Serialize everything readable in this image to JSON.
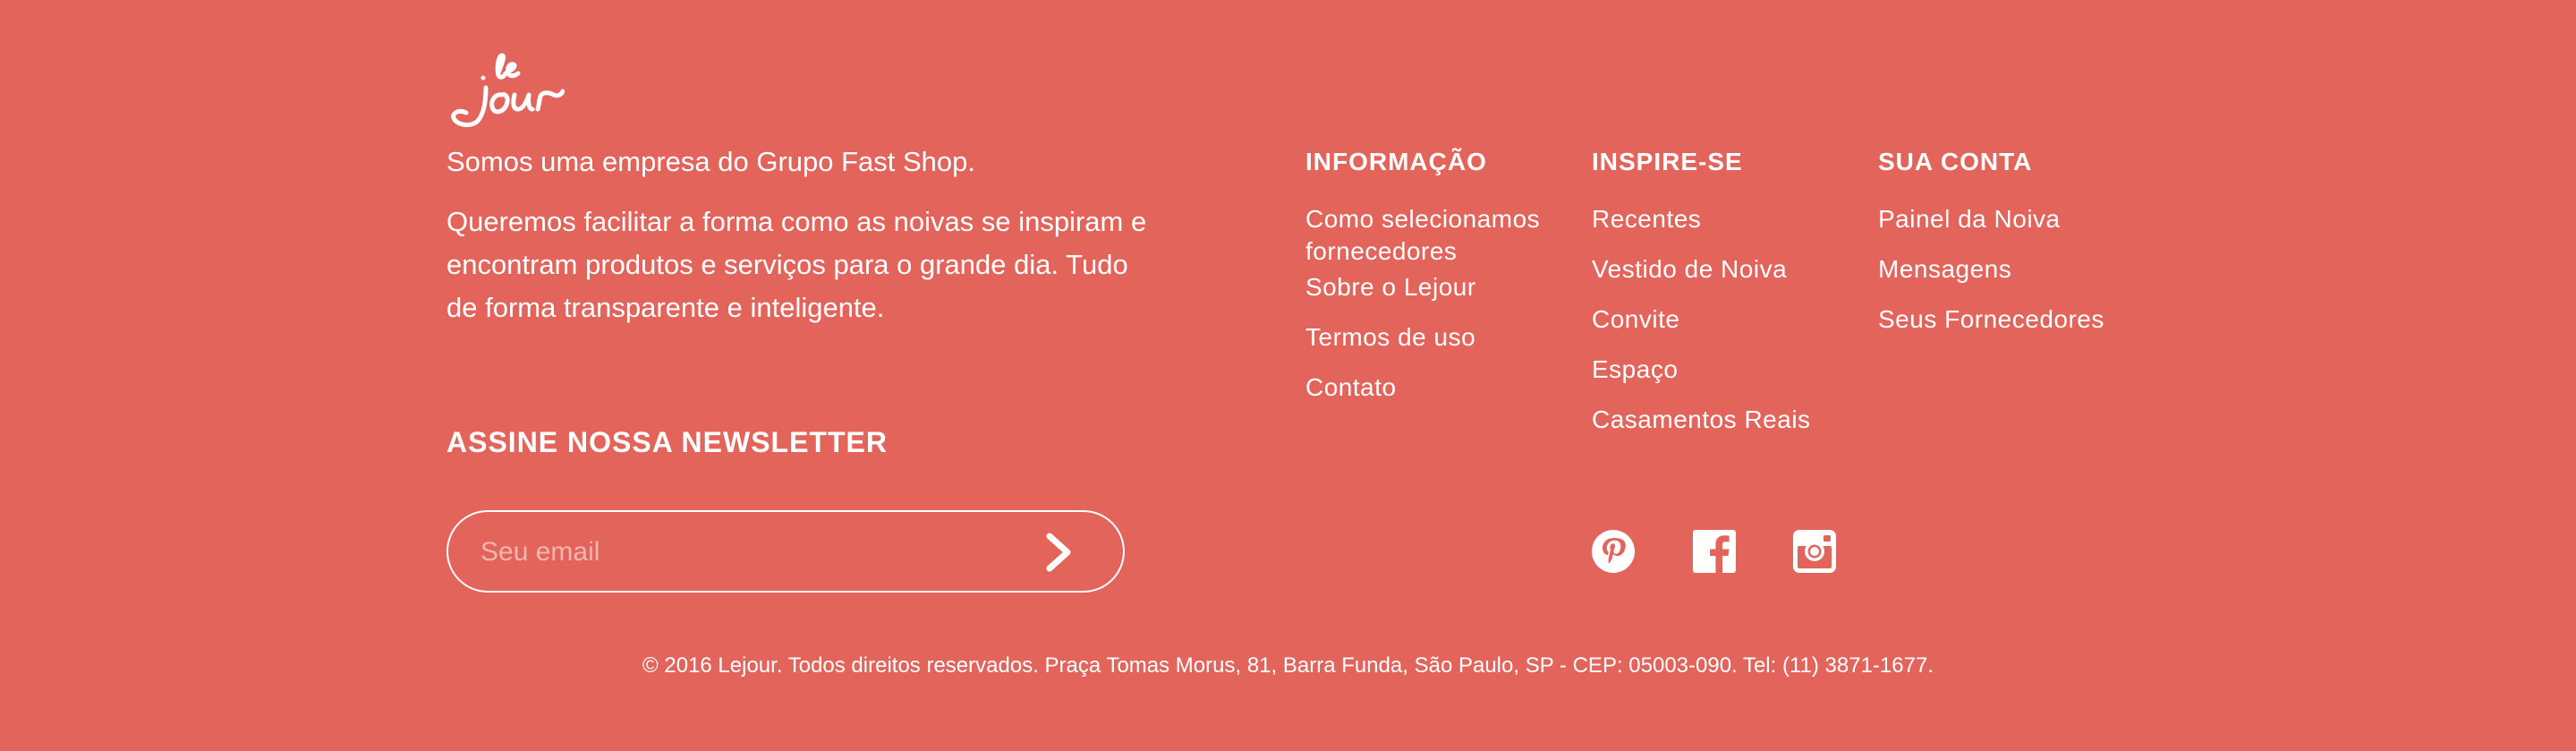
{
  "brand": {
    "logo_text": "le jour",
    "background_color": "#e2645b"
  },
  "about": {
    "line1": "Somos uma empresa do Grupo Fast Shop.",
    "line2": "Queremos facilitar a forma como as noivas se inspiram e encontram produtos e serviços para o grande dia. Tudo de forma transparente e inteligente."
  },
  "newsletter": {
    "title": "ASSINE NOSSA NEWSLETTER",
    "placeholder": "Seu email",
    "submit_icon": "chevron-right-icon"
  },
  "columns": {
    "info": {
      "title": "INFORMAÇÃO",
      "links": [
        "Como selecionamos fornecedores",
        "Sobre o Lejour",
        "Termos de uso",
        "Contato"
      ]
    },
    "inspire": {
      "title": "INSPIRE-SE",
      "links": [
        "Recentes",
        "Vestido de Noiva",
        "Convite",
        "Espaço",
        "Casamentos Reais"
      ]
    },
    "account": {
      "title": "SUA CONTA",
      "links": [
        "Painel da Noiva",
        "Mensagens",
        "Seus Fornecedores"
      ]
    }
  },
  "social": [
    {
      "icon": "pinterest-icon"
    },
    {
      "icon": "facebook-icon"
    },
    {
      "icon": "instagram-icon"
    }
  ],
  "copyright": "© 2016 Lejour. Todos direitos reservados. Praça Tomas Morus, 81, Barra Funda, São Paulo, SP - CEP: 05003-090. Tel: (11) 3871-1677."
}
